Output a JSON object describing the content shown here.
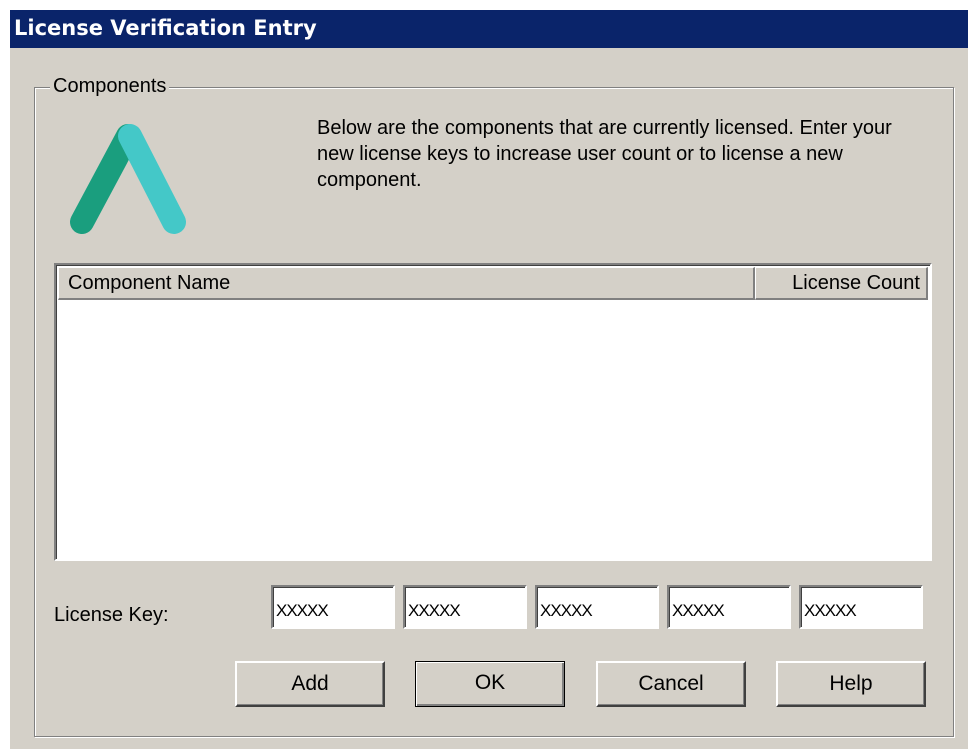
{
  "window": {
    "title": "License Verification Entry"
  },
  "components_group": {
    "label": "Components",
    "logo_icon": "app-logo-icon",
    "description": "Below are the components that are currently licensed. Enter your new license keys to increase user count or to license a new component."
  },
  "component_list": {
    "columns": [
      {
        "label": "Component Name"
      },
      {
        "label": "License Count"
      }
    ],
    "rows": []
  },
  "license_key": {
    "label": "License Key:",
    "segments": [
      {
        "value": "XXXXX"
      },
      {
        "value": "XXXXX"
      },
      {
        "value": "XXXXX"
      },
      {
        "value": "XXXXX"
      },
      {
        "value": "XXXXX"
      }
    ]
  },
  "buttons": {
    "add": "Add",
    "ok": "OK",
    "cancel": "Cancel",
    "help": "Help"
  },
  "colors": {
    "titlebar": "#0a246a",
    "dialog_face": "#d4d0c8",
    "logo_dark": "#1a9e7e",
    "logo_light": "#44c8c8"
  }
}
